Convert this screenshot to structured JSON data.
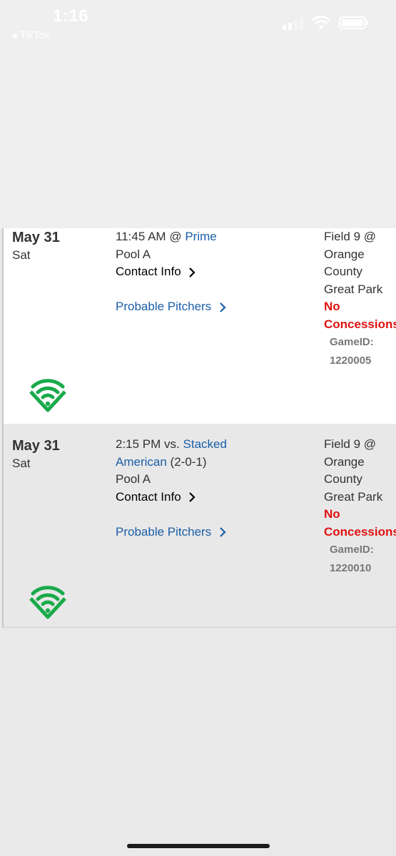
{
  "status_bar": {
    "time": "1:16",
    "back_app": "◂ TikTok"
  },
  "games": [
    {
      "date": "May 31",
      "day": "Sat",
      "time": "11:45 AM",
      "separator": "@",
      "opponent": "Prime",
      "opponent_record": "",
      "pool": "Pool A",
      "contact_label": "Contact Info",
      "pitchers_label": "Probable Pitchers",
      "field_label": "Field 9 @",
      "venue_lines": [
        "Orange",
        "County",
        "Great Park"
      ],
      "concessions_lines": [
        "No",
        "Concessions"
      ],
      "game_id_label": "GameID:",
      "game_id": "1220005",
      "icon": "baseball-field-icon"
    },
    {
      "date": "May 31",
      "day": "Sat",
      "time": "2:15 PM",
      "separator": "vs.",
      "opponent_line1": "Stacked",
      "opponent_line2": "American",
      "opponent_record": "(2-0-1)",
      "pool": "Pool A",
      "contact_label": "Contact Info",
      "pitchers_label": "Probable Pitchers",
      "field_label": "Field 9 @",
      "venue_lines": [
        "Orange",
        "County",
        "Great Park"
      ],
      "concessions_lines": [
        "No",
        "Concessions"
      ],
      "game_id_label": "GameID:",
      "game_id": "1220010",
      "icon": "baseball-field-icon"
    }
  ],
  "colors": {
    "link": "#1a5ea8",
    "alert": "#e01010",
    "icon_green": "#1aaa4a"
  }
}
